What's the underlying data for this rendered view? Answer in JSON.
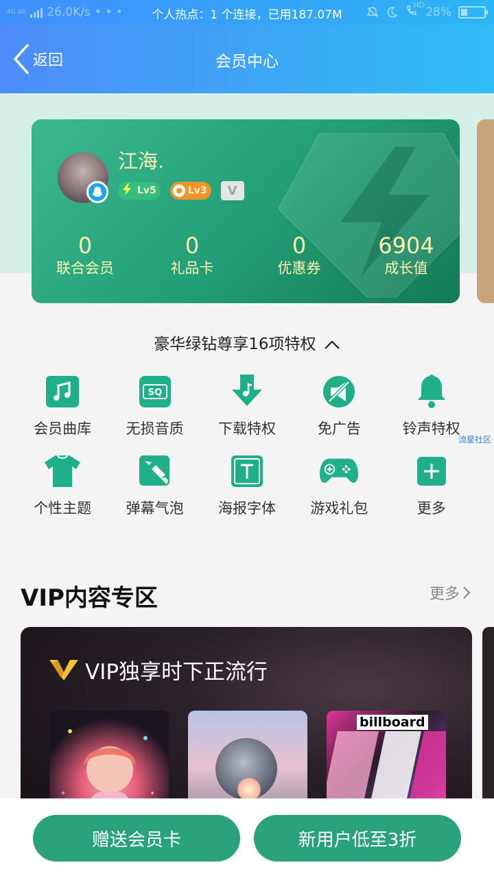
{
  "status_bar": {
    "network": "4G 4G",
    "speed": "26.0K/s",
    "hotspot": "个人热点：1 个连接，已用187.07M",
    "hd": "HD",
    "battery": "28%",
    "battery_level": 0.28
  },
  "nav": {
    "back_label": "返回",
    "title": "会员中心"
  },
  "card": {
    "username": "江海.",
    "badges": [
      {
        "label": "Lv5",
        "color": "#3ccd78"
      },
      {
        "label": "Lv3",
        "color": "#f0932b"
      },
      {
        "label": "V",
        "color": "#e5e5e5"
      }
    ],
    "stats": [
      {
        "value": "0",
        "label": "联合会员"
      },
      {
        "value": "0",
        "label": "礼品卡"
      },
      {
        "value": "0",
        "label": "优惠券"
      },
      {
        "value": "6904",
        "label": "成长值"
      }
    ],
    "accent_color": "#23a078"
  },
  "privileges": {
    "title": "豪华绿钻尊享16项特权",
    "items": [
      {
        "label": "会员曲库",
        "icon": "music-note-icon"
      },
      {
        "label": "无损音质",
        "icon": "sq-icon"
      },
      {
        "label": "下载特权",
        "icon": "download-icon"
      },
      {
        "label": "免广告",
        "icon": "no-ads-icon"
      },
      {
        "label": "铃声特权",
        "icon": "bell-icon"
      },
      {
        "label": "个性主题",
        "icon": "tshirt-icon"
      },
      {
        "label": "弹幕气泡",
        "icon": "bubble-icon"
      },
      {
        "label": "海报字体",
        "icon": "font-icon"
      },
      {
        "label": "游戏礼包",
        "icon": "gamepad-icon"
      },
      {
        "label": "更多",
        "icon": "plus-icon"
      }
    ],
    "icon_color": "#1fb08a"
  },
  "watermark": "流星社区",
  "vip_zone": {
    "title": "VIP内容专区",
    "more_label": "更多",
    "banner_title": "VIP独享时下正流行",
    "album3_logo": "billboard"
  },
  "bottom": {
    "gift_button": "赠送会员卡",
    "newuser_button": "新用户低至3折",
    "button_color": "#2aa37c"
  }
}
